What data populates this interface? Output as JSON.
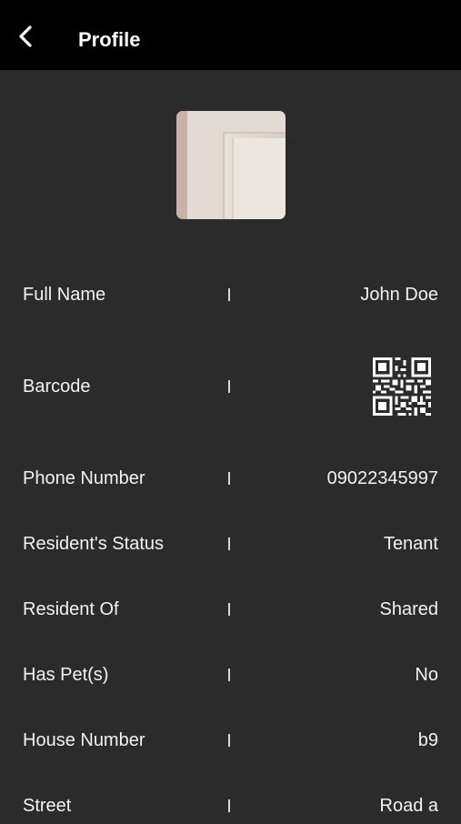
{
  "header": {
    "title": "Profile",
    "back_icon": "chevron-left-icon"
  },
  "avatar": {
    "description_icon": "profile-photo"
  },
  "fields": [
    {
      "label": "Full Name",
      "separator": "|",
      "value": "John Doe"
    },
    {
      "label": "Barcode",
      "separator": "|",
      "value_icon": "qr-code-icon"
    },
    {
      "label": "Phone Number",
      "separator": "|",
      "value": "09022345997"
    },
    {
      "label": "Resident's Status",
      "separator": "|",
      "value": "Tenant"
    },
    {
      "label": "Resident Of",
      "separator": "|",
      "value": "Shared"
    },
    {
      "label": "Has Pet(s)",
      "separator": "|",
      "value": "No"
    },
    {
      "label": "House Number",
      "separator": "|",
      "value": "b9"
    },
    {
      "label": "Street",
      "separator": "|",
      "value": "Road a"
    }
  ],
  "colors": {
    "header_bg": "#000000",
    "page_bg": "#2b2b2b",
    "text": "#f2f2f2"
  }
}
